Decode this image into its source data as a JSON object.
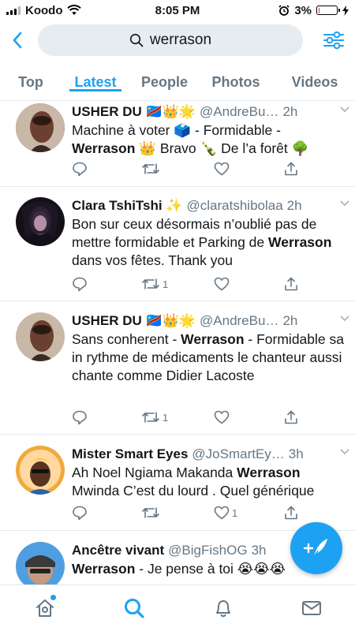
{
  "status_bar": {
    "carrier": "Koodo",
    "time": "8:05 PM",
    "battery": "3%",
    "battery_level": 0.03
  },
  "search": {
    "query": "werrason"
  },
  "tabs": [
    {
      "label": "Top",
      "active": false
    },
    {
      "label": "Latest",
      "active": true
    },
    {
      "label": "People",
      "active": false
    },
    {
      "label": "Photos",
      "active": false
    },
    {
      "label": "Videos",
      "active": false
    }
  ],
  "tweets": [
    {
      "name": "USHER DU 🇨🇩👑🌟",
      "handle": "@AndreBu…",
      "time": "2h",
      "text_parts": [
        "Machine à voter 🗳️ - Formidable - ",
        "Werrason",
        " 👑 Bravo 🍾 De l’a forêt 🌳"
      ],
      "retweets": "",
      "likes": ""
    },
    {
      "name": "Clara TshiTshi ✨",
      "handle": "@claratshibolaa",
      "time": "2h",
      "text_parts": [
        "Bon sur ceux désormais n’oublié pas de mettre formidable et Parking de ",
        "Werrason",
        " dans vos fêtes. Thank you"
      ],
      "retweets": "1",
      "likes": ""
    },
    {
      "name": "USHER DU 🇨🇩👑🌟",
      "handle": "@AndreBu…",
      "time": "2h",
      "text_parts": [
        "Sans conherent - ",
        "Werrason",
        " - Formidable  sa in rythme de médicaments le chanteur aussi chante comme Didier Lacoste"
      ],
      "retweets": "1",
      "likes": ""
    },
    {
      "name": "Mister Smart Eyes",
      "handle": "@JoSmartEy…",
      "time": "3h",
      "text_parts": [
        "Ah Noel Ngiama Makanda ",
        "Werrason",
        " Mwinda C’est du lourd . Quel générique"
      ],
      "retweets": "",
      "likes": "1"
    },
    {
      "name": "Ancêtre vivant",
      "handle": "@BigFishOG",
      "time": "3h",
      "text_parts": [
        "",
        "Werrason",
        " - Je pense à toi 😭😭😭"
      ],
      "retweets": "",
      "likes": ""
    }
  ],
  "colors": {
    "accent": "#1da1f2",
    "text": "#14171a",
    "muted": "#657786",
    "divider": "#e1e8ed"
  }
}
